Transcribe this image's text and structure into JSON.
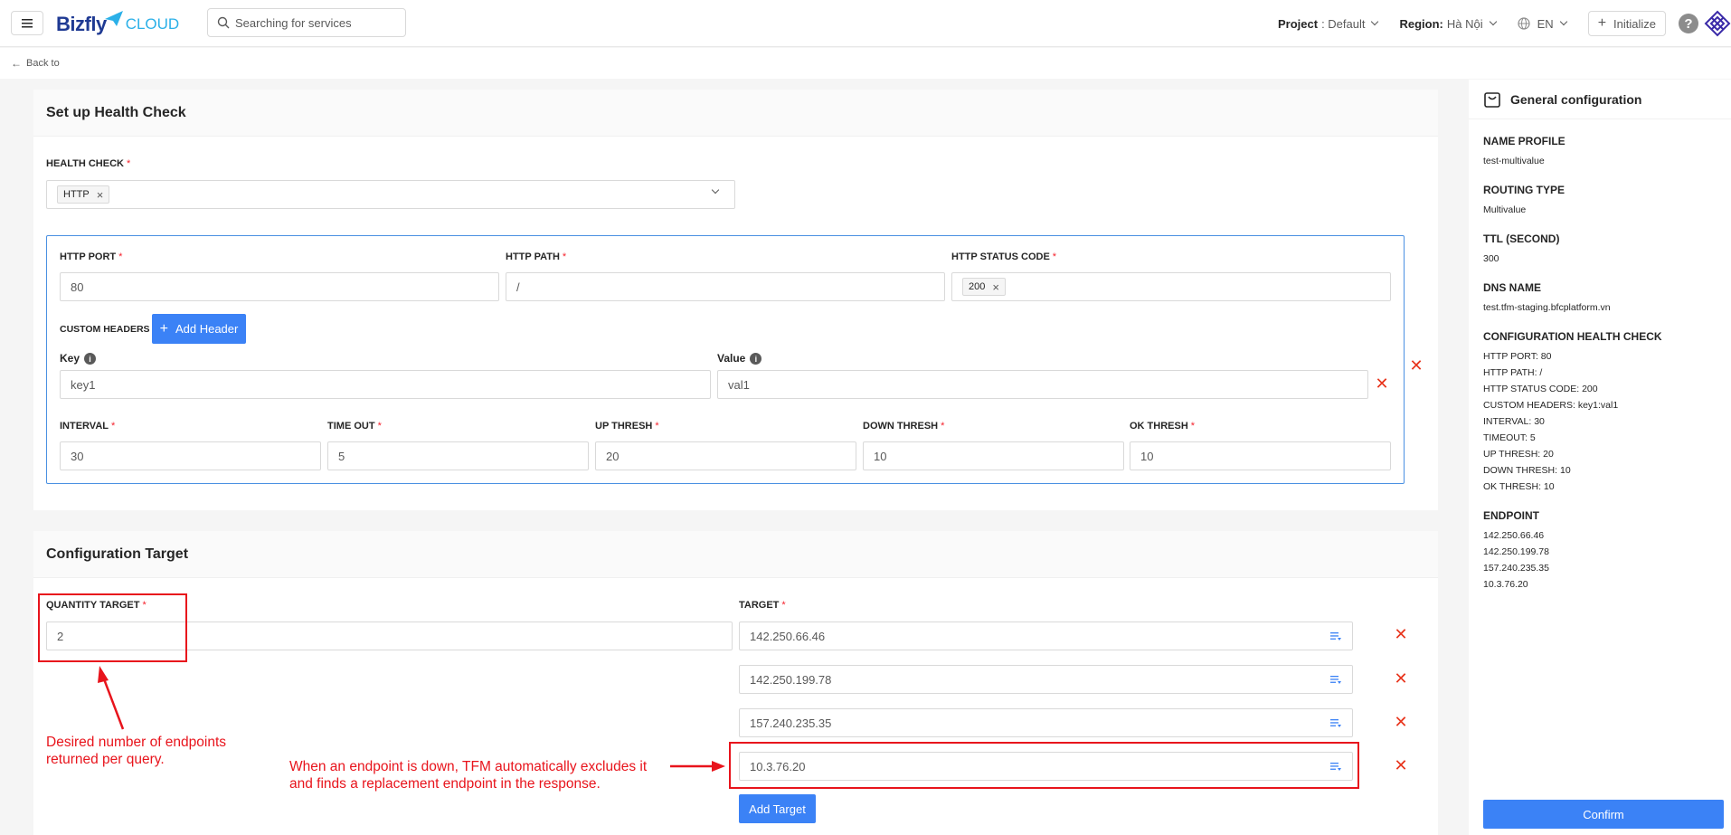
{
  "header": {
    "brand_main": "Bizfly",
    "brand_sub": "CLOUD",
    "search_placeholder": "Searching for services",
    "project_label": "Project",
    "project_value": ": Default",
    "region_label": "Region:",
    "region_value": "Hà Nội",
    "language": "EN",
    "initialize_label": "Initialize",
    "help": "?"
  },
  "back_label": "Back to",
  "health": {
    "title": "Set up Health Check",
    "health_check_label": "HEALTH CHECK",
    "health_check_tag": "HTTP",
    "http_port_label": "HTTP PORT",
    "http_port_value": "80",
    "http_path_label": "HTTP PATH",
    "http_path_value": "/",
    "http_status_label": "HTTP STATUS CODE",
    "http_status_tag": "200",
    "custom_headers_label": "CUSTOM HEADERS",
    "add_header_label": "Add Header",
    "key_label": "Key",
    "value_label": "Value",
    "key_value": "key1",
    "value_value": "val1",
    "interval_label": "INTERVAL",
    "interval_value": "30",
    "timeout_label": "TIME OUT",
    "timeout_value": "5",
    "up_thresh_label": "UP THRESH",
    "up_thresh_value": "20",
    "down_thresh_label": "DOWN THRESH",
    "down_thresh_value": "10",
    "ok_thresh_label": "OK THRESH",
    "ok_thresh_value": "10"
  },
  "target": {
    "title": "Configuration Target",
    "quantity_label": "QUANTITY TARGET",
    "quantity_value": "2",
    "target_label": "TARGET",
    "targets": [
      "142.250.66.46",
      "142.250.199.78",
      "157.240.235.35",
      "10.3.76.20"
    ],
    "add_target_label": "Add Target"
  },
  "summary": {
    "title": "General configuration",
    "name_profile_title": "NAME PROFILE",
    "name_profile": "test-multivalue",
    "routing_type_title": "ROUTING TYPE",
    "routing_type": "Multivalue",
    "ttl_title": "TTL (SECOND)",
    "ttl": "300",
    "dns_title": "DNS NAME",
    "dns": "test.tfm-staging.bfcplatform.vn",
    "hc_title": "CONFIGURATION HEALTH CHECK",
    "hc_lines": [
      "HTTP PORT: 80",
      "HTTP PATH: /",
      "HTTP STATUS CODE: 200",
      "CUSTOM HEADERS: key1:val1",
      "INTERVAL: 30",
      "TIMEOUT: 5",
      "UP THRESH: 20",
      "DOWN THRESH: 10",
      "OK THRESH: 10"
    ],
    "endpoint_title": "ENDPOINT",
    "endpoints": [
      "142.250.66.46",
      "142.250.199.78",
      "157.240.235.35",
      "10.3.76.20"
    ],
    "confirm_label": "Confirm"
  },
  "annotations": {
    "quantity_note_1": "Desired number of endpoints",
    "quantity_note_2": "returned per query.",
    "down_note_1": "When an endpoint is down, TFM automatically excludes it",
    "down_note_2": "and finds a replacement endpoint in the response."
  },
  "colors": {
    "primary": "#3b82f6",
    "danger": "#e8341c",
    "annotation": "#e8141c"
  }
}
